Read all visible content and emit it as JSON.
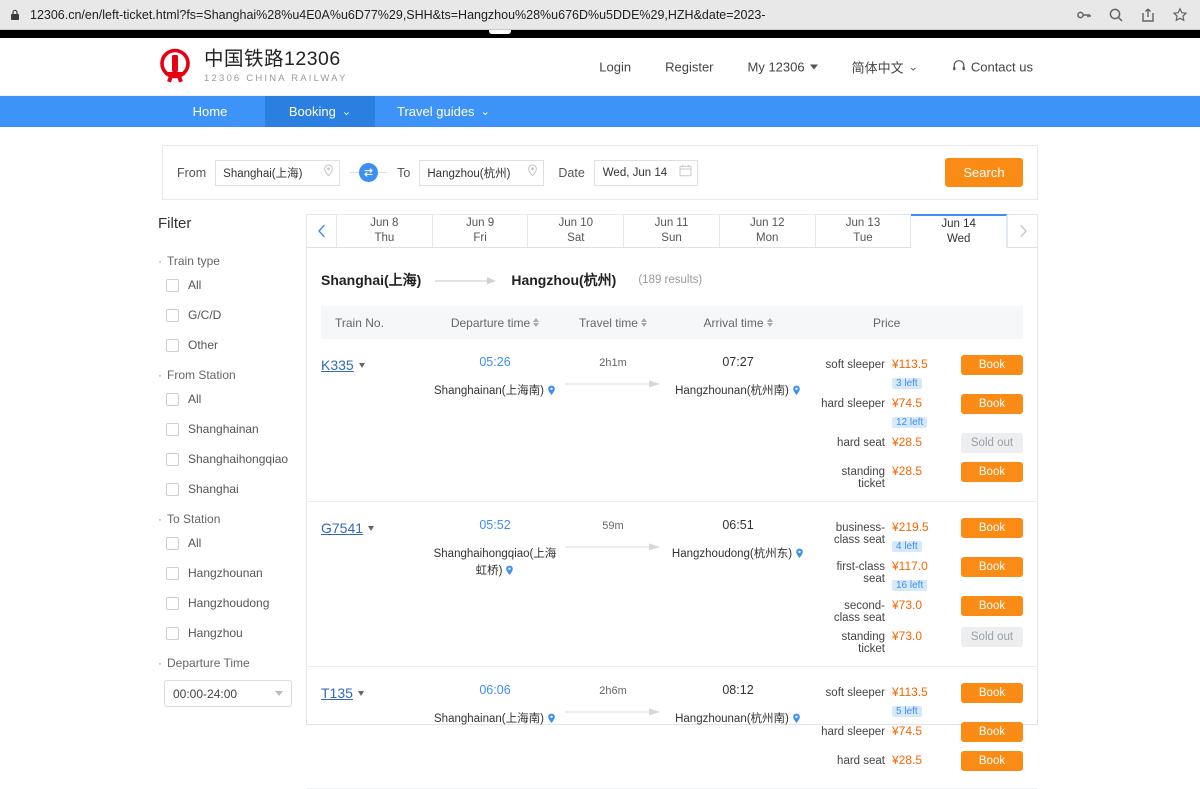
{
  "browser": {
    "url": "12306.cn/en/left-ticket.html?fs=Shanghai%28%u4E0A%u6D77%29,SHH&ts=Hangzhou%28%u676D%u5DDE%29,HZH&date=2023-",
    "icons": [
      "lock-icon",
      "key-icon",
      "search-icon",
      "share-icon",
      "bookmark-star-icon"
    ]
  },
  "header": {
    "logo_cn": "中国铁路12306",
    "logo_en": "12306 CHINA RAILWAY",
    "nav": [
      {
        "label": "Login",
        "caret": false
      },
      {
        "label": "Register",
        "caret": false
      },
      {
        "label": "My 12306",
        "caret": true
      },
      {
        "label": "简体中文",
        "chevron": true
      },
      {
        "label": "Contact us",
        "icon": "headset-icon"
      }
    ]
  },
  "mainnav": {
    "items": [
      {
        "label": "Home",
        "active": false,
        "caret": false
      },
      {
        "label": "Booking",
        "active": true,
        "caret": true
      },
      {
        "label": "Travel guides",
        "active": false,
        "caret": true
      }
    ]
  },
  "search": {
    "from_label": "From",
    "from_value": "Shanghai(上海)",
    "to_label": "To",
    "to_value": "Hangzhou(杭州)",
    "date_label": "Date",
    "date_value": "Wed, Jun 14",
    "search_button": "Search",
    "swap_icon": "swap-icon",
    "accent": "#fa8c16"
  },
  "filter": {
    "title": "Filter",
    "groups": [
      {
        "title": "Train type",
        "options": [
          "All",
          "G/C/D",
          "Other"
        ]
      },
      {
        "title": "From Station",
        "options": [
          "All",
          "Shanghainan",
          "Shanghaihongqiao",
          "Shanghai"
        ]
      },
      {
        "title": "To Station",
        "options": [
          "All",
          "Hangzhounan",
          "Hangzhoudong",
          "Hangzhou"
        ]
      }
    ],
    "departure_time_title": "Departure Time",
    "departure_time_value": "00:00-24:00"
  },
  "date_tabs": {
    "prev_icon": "chevron-left-icon",
    "next_icon": "chevron-right-icon",
    "tabs": [
      {
        "date": "Jun 8",
        "day": "Thu",
        "active": false
      },
      {
        "date": "Jun 9",
        "day": "Fri",
        "active": false
      },
      {
        "date": "Jun 10",
        "day": "Sat",
        "active": false
      },
      {
        "date": "Jun 11",
        "day": "Sun",
        "active": false
      },
      {
        "date": "Jun 12",
        "day": "Mon",
        "active": false
      },
      {
        "date": "Jun 13",
        "day": "Tue",
        "active": false
      },
      {
        "date": "Jun 14",
        "day": "Wed",
        "active": true
      }
    ]
  },
  "route": {
    "origin": "Shanghai(上海)",
    "destination": "Hangzhou(杭州)",
    "results": "(189 results)"
  },
  "table": {
    "columns": [
      {
        "label": "Train No.",
        "sortable": false
      },
      {
        "label": "Departure time",
        "sortable": true
      },
      {
        "label": "Travel time",
        "sortable": true
      },
      {
        "label": "Arrival time",
        "sortable": true
      },
      {
        "label": "Price",
        "sortable": false
      }
    ]
  },
  "trains": [
    {
      "train_no": "K335",
      "depart_time": "05:26",
      "depart_station": "Shanghainan(上海南)",
      "travel_time": "2h1m",
      "arrive_time": "07:27",
      "arrive_station": "Hangzhounan(杭州南)",
      "seats": [
        {
          "name": "soft sleeper",
          "price": "¥113.5",
          "left": "3 left",
          "action": "Book",
          "sold_out": false
        },
        {
          "name": "hard sleeper",
          "price": "¥74.5",
          "left": "12 left",
          "action": "Book",
          "sold_out": false
        },
        {
          "name": "hard seat",
          "price": "¥28.5",
          "left": "",
          "action": "Sold out",
          "sold_out": true
        },
        {
          "name": "standing ticket",
          "price": "¥28.5",
          "left": "",
          "action": "Book",
          "sold_out": false
        }
      ]
    },
    {
      "train_no": "G7541",
      "depart_time": "05:52",
      "depart_station": "Shanghaihongqiao(上海虹桥)",
      "travel_time": "59m",
      "arrive_time": "06:51",
      "arrive_station": "Hangzhoudong(杭州东)",
      "seats": [
        {
          "name": "business-class seat",
          "price": "¥219.5",
          "left": "4 left",
          "action": "Book",
          "sold_out": false
        },
        {
          "name": "first-class seat",
          "price": "¥117.0",
          "left": "16 left",
          "action": "Book",
          "sold_out": false
        },
        {
          "name": "second-class seat",
          "price": "¥73.0",
          "left": "",
          "action": "Book",
          "sold_out": false
        },
        {
          "name": "standing ticket",
          "price": "¥73.0",
          "left": "",
          "action": "Sold out",
          "sold_out": true
        }
      ]
    },
    {
      "train_no": "T135",
      "depart_time": "06:06",
      "depart_station": "Shanghainan(上海南)",
      "travel_time": "2h6m",
      "arrive_time": "08:12",
      "arrive_station": "Hangzhounan(杭州南)",
      "seats": [
        {
          "name": "soft sleeper",
          "price": "¥113.5",
          "left": "5 left",
          "action": "Book",
          "sold_out": false
        },
        {
          "name": "hard sleeper",
          "price": "¥74.5",
          "left": "",
          "action": "Book",
          "sold_out": false
        },
        {
          "name": "hard seat",
          "price": "¥28.5",
          "left": "",
          "action": "Book",
          "sold_out": false
        }
      ]
    }
  ]
}
